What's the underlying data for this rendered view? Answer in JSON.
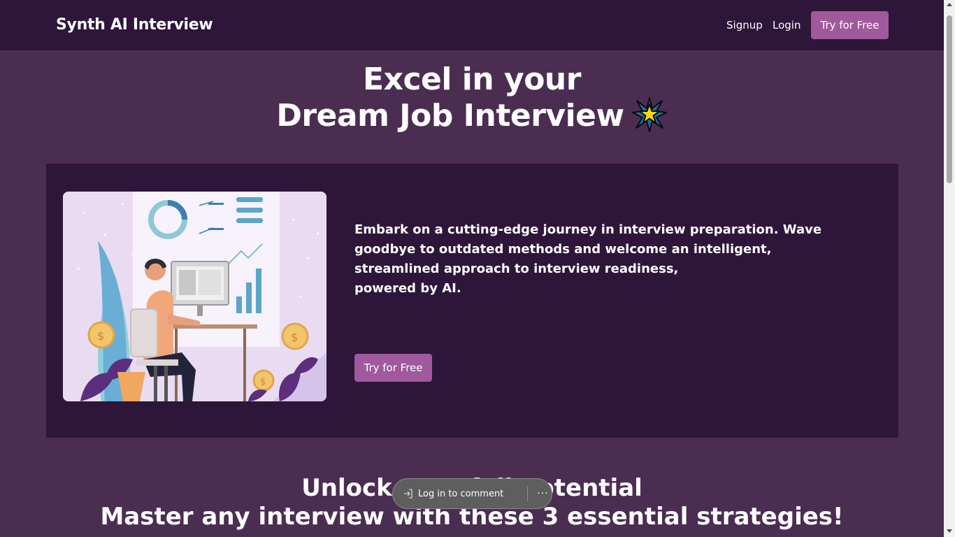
{
  "header": {
    "brand": "Synth AI Interview",
    "signup_label": "Signup",
    "login_label": "Login",
    "try_label": "Try for Free"
  },
  "hero": {
    "title_line1": "Excel in your",
    "title_line2": "Dream Job Interview",
    "title_icon": "glowing-star-icon"
  },
  "feature_card": {
    "illustration_icon": "person-at-computer-illustration",
    "line1": "Embark on a cutting-edge journey in interview preparation. Wave goodbye to outdated methods and welcome an intelligent, streamlined approach to interview readiness,",
    "line2": "powered by AI.",
    "button_label": "Try for Free"
  },
  "strategies": {
    "title_line1": "Unlock your full potential",
    "title_line2": "Master any interview with these 3 essential strategies!"
  },
  "comment_toolbar": {
    "label": "Log in to comment",
    "more": "···"
  },
  "colors": {
    "page_background": "#4b2d52",
    "navbar_background": "#2e163a",
    "card_background": "#2e163a",
    "accent_button": "#a0599a"
  }
}
